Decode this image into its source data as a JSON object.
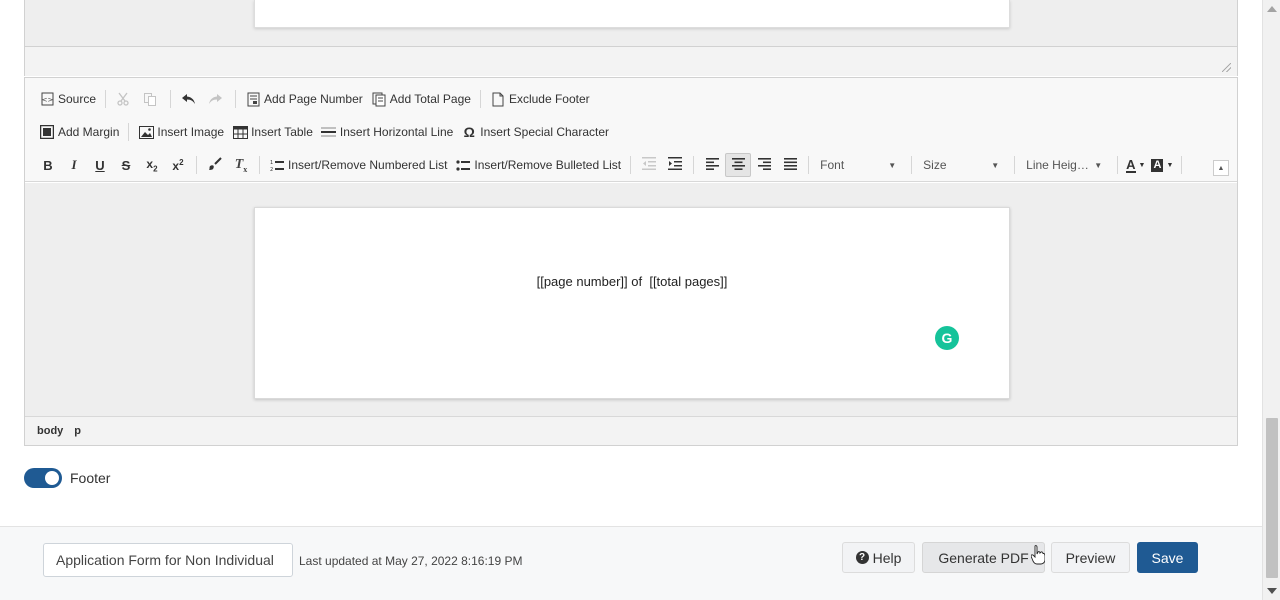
{
  "toolbar": {
    "row1": {
      "source": "Source",
      "add_page_number": "Add Page Number",
      "add_total_page": "Add Total Page",
      "exclude_footer": "Exclude Footer"
    },
    "row2": {
      "add_margin": "Add Margin",
      "insert_image": "Insert Image",
      "insert_table": "Insert Table",
      "insert_horizontal_line": "Insert Horizontal Line",
      "insert_special_character": "Insert Special Character"
    },
    "row3": {
      "bold": "B",
      "italic": "I",
      "underline": "U",
      "strike": "S",
      "numbered_list": "Insert/Remove Numbered List",
      "bulleted_list": "Insert/Remove Bulleted List",
      "font": "Font",
      "size": "Size",
      "line_height": "Line Heig…"
    }
  },
  "editor": {
    "content_text": "[[page number]] of  [[total pages]]",
    "path": [
      "body",
      "p"
    ]
  },
  "footer_toggle": {
    "label": "Footer",
    "on": true
  },
  "bottom_bar": {
    "name_value": "Application Form for Non Individual",
    "last_updated": "Last updated at May 27, 2022 8:16:19 PM",
    "help_label": "Help",
    "generate_pdf_label": "Generate PDF",
    "preview_label": "Preview",
    "save_label": "Save"
  },
  "colors": {
    "primary": "#1f5a93",
    "grammarly": "#15c39a"
  }
}
